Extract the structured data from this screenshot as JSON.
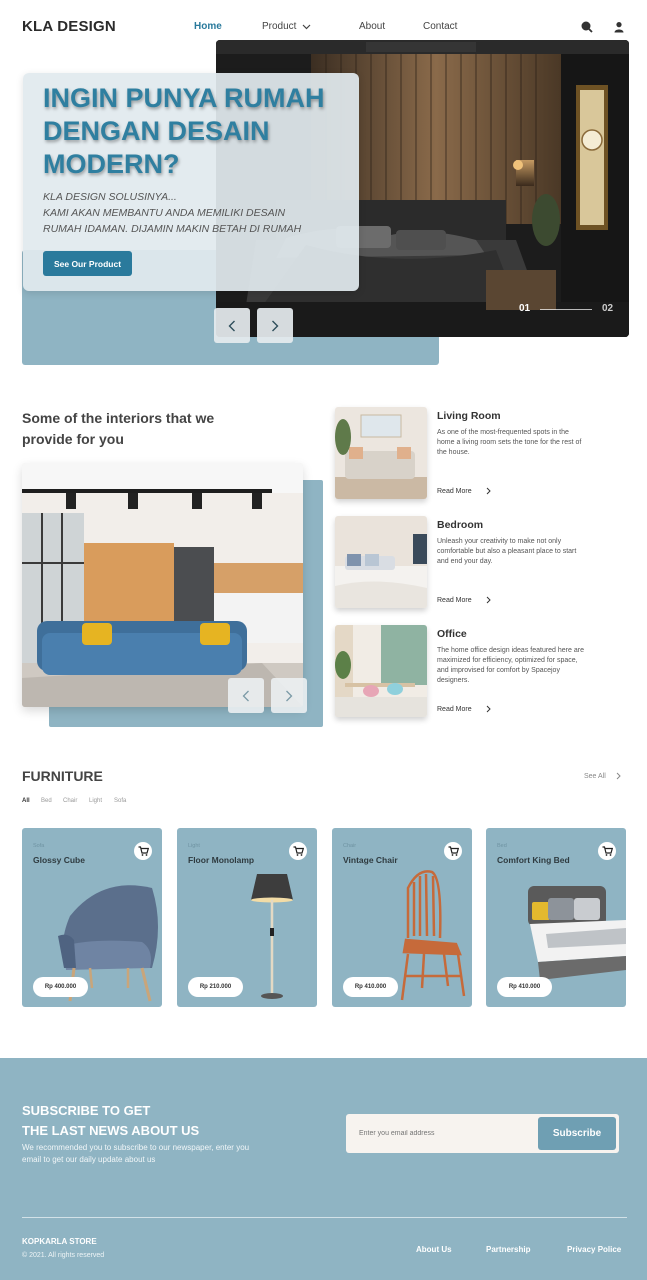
{
  "brand": {
    "logo": "KLA DESIGN"
  },
  "nav": {
    "items": [
      {
        "label": "Home",
        "active": true
      },
      {
        "label": "Product",
        "active": false
      },
      {
        "label": "About",
        "active": false
      },
      {
        "label": "Contact",
        "active": false
      }
    ],
    "icons": [
      "search-icon",
      "user-icon"
    ]
  },
  "hero": {
    "title": "INGIN PUNYA RUMAH DENGAN DESAIN MODERN?",
    "subtitle_line1": "KLA DESIGN SOLUSINYA...",
    "subtitle_line2": "KAMI AKAN MEMBANTU ANDA MEMILIKI DESAIN",
    "subtitle_line3": "RUMAH IDAMAN. DIJAMIN MAKIN BETAH DI RUMAH",
    "cta": "See Our Product",
    "slide_current": "01",
    "slide_total": "02"
  },
  "interiors": {
    "title": "Some of the interiors that we provide for you",
    "rooms": [
      {
        "title": "Living Room",
        "desc": "As one of the most-frequented spots in the home a living room sets the tone for the rest of the house.",
        "more": "Read More"
      },
      {
        "title": "Bedroom",
        "desc": " Unleash your creativity to make not only comfortable but also a pleasant place to start and end your day.",
        "more": "Read More"
      },
      {
        "title": "Office",
        "desc": "The home office design ideas featured here are maximized for efficiency, optimized for space, and improvised for comfort by Spacejoy designers.",
        "more": "Read More"
      }
    ]
  },
  "furniture": {
    "title": "FURNITURE",
    "see_all": "See All",
    "filters": [
      "All",
      "Bed",
      "Chair",
      "Light",
      "Sofa"
    ],
    "products": [
      {
        "category": "Sofa",
        "name": "Glossy Cube",
        "price": "Rp 400.000"
      },
      {
        "category": "Light",
        "name": "Floor Monolamp",
        "price": "Rp 210.000"
      },
      {
        "category": "Chair",
        "name": "Vintage Chair",
        "price": "Rp 410.000"
      },
      {
        "category": "Bed",
        "name": "Comfort King Bed",
        "price": "Rp 410.000"
      }
    ]
  },
  "subscribe": {
    "title_line1": "SUBSCRIBE TO GET",
    "title_line2": "THE LAST NEWS ABOUT US",
    "desc": "We recommended you to subscribe to our newspaper, enter you email to get our daily update about us",
    "placeholder": "Enter you email address",
    "button": "Subscribe"
  },
  "footer": {
    "store": "KOPKARLA STORE",
    "copyright": "© 2021. All rights reserved",
    "links": [
      "About Us",
      "Partnership",
      "Privacy Police"
    ]
  },
  "colors": {
    "accent": "#2a7a9c",
    "panel": "#8fb4c3",
    "footer": "#8fb4c3"
  }
}
